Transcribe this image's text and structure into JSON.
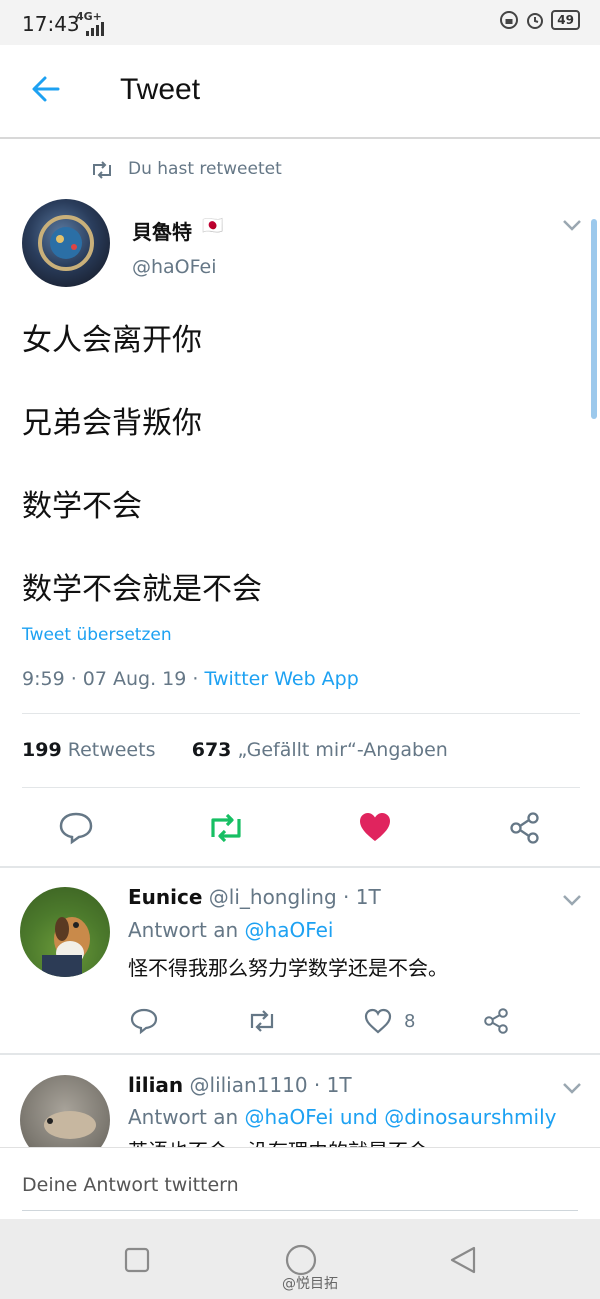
{
  "status": {
    "time": "17:43",
    "network": "4G+",
    "battery": "49"
  },
  "header": {
    "title": "Tweet"
  },
  "retweet_banner": "Du hast retweetet",
  "tweet": {
    "display_name": "貝魯特",
    "flag": "🇯🇵",
    "handle": "@haOFei",
    "lines": [
      "女人会离开你",
      "兄弟会背叛你",
      "数学不会",
      "数学不会就是不会"
    ],
    "translate": "Tweet übersetzen",
    "meta_time": "9:59 · 07 Aug. 19 · ",
    "meta_source": "Twitter Web App",
    "retweets_count": "199",
    "retweets_label": "Retweets",
    "likes_count": "673",
    "likes_label": "„Gefällt mir“-Angaben"
  },
  "replies": [
    {
      "name": "Eunice",
      "handle_time": "@li_hongling · 1T",
      "reply_to_prefix": "Antwort an ",
      "reply_to": "@haOFei",
      "text": "怪不得我那么努力学数学还是不会。",
      "like_count": "8"
    },
    {
      "name": "lilian",
      "handle_time": "@lilian1110 · 1T",
      "reply_to_prefix": "Antwort an ",
      "reply_to": "@haOFei und @dinosaurshmily",
      "text": "英语也不会，没有理由的就是不会"
    }
  ],
  "compose": {
    "placeholder": "Deine Antwort twittern"
  },
  "watermark": "@悦目拓",
  "colors": {
    "twitter_blue": "#1da1f2",
    "retweet_green": "#17bf63",
    "like_red": "#e0245e",
    "muted": "#657786"
  }
}
